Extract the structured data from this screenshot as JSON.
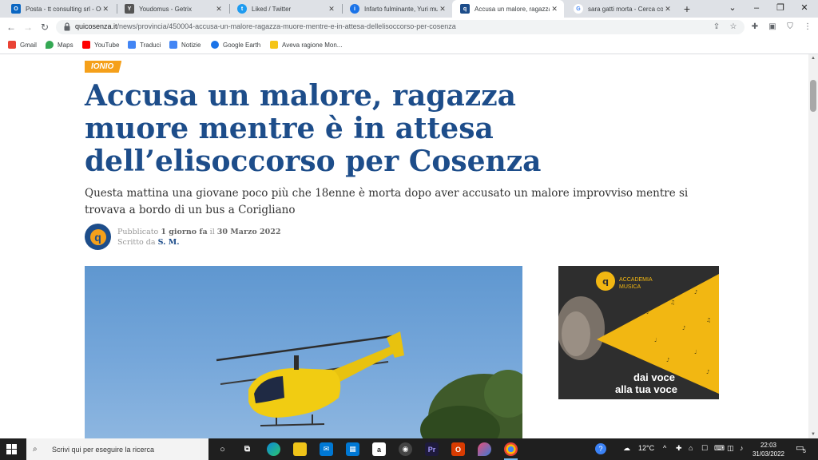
{
  "browser": {
    "tabs": [
      {
        "title": "Posta - tt consulting srl - Ou",
        "color": "#0a66c2",
        "glyph": "O"
      },
      {
        "title": "Youdomus - Getrix",
        "color": "#555555",
        "glyph": "Y"
      },
      {
        "title": "Liked / Twitter",
        "color": "#1d9bf0",
        "glyph": "t"
      },
      {
        "title": "Infarto fulminante, Yuri mu",
        "color": "#1a73e8",
        "glyph": "i"
      },
      {
        "title": "Accusa un malore, ragazza",
        "color": "#1d4d8a",
        "glyph": "q"
      },
      {
        "title": "sara gatti morta - Cerca co",
        "color": "#ffffff",
        "glyph": "G"
      }
    ],
    "new_tab": "+",
    "window_controls": [
      "⌄",
      "–",
      "❐",
      "✕"
    ],
    "url_domain": "quicosenza.it",
    "url_path": "/news/provincia/450004-accusa-un-malore-ragazza-muore-mentre-e-in-attesa-dellelisoccorso-per-cosenza",
    "bookmarks": [
      {
        "label": "Gmail",
        "color": "#ea4335"
      },
      {
        "label": "Maps",
        "color": "#34a853"
      },
      {
        "label": "YouTube",
        "color": "#ff0000"
      },
      {
        "label": "Traduci",
        "color": "#4285f4"
      },
      {
        "label": "Notizie",
        "color": "#4285f4"
      },
      {
        "label": "Google Earth",
        "color": "#1a73e8"
      },
      {
        "label": "Aveva ragione Mon...",
        "color": "#f5c518"
      }
    ]
  },
  "article": {
    "category": "IONIO",
    "headline": "Accusa un malore, ragazza muore mentre è in attesa dell’elisoccorso per Cosenza",
    "subhead": "Questa mattina una giovane poco più che 18enne è morta dopo aver accusato un malore improvviso mentre si trovava a bordo di un bus a Corigliano",
    "published_prefix": "Pubblicato",
    "published_relative": "1 giorno fa",
    "published_mid": "il",
    "published_date": "30 Marzo 2022",
    "written_prefix": "Scritto da",
    "author": "S. M."
  },
  "ad": {
    "brand_line1": "ACCADEMIA",
    "brand_line2": "MUSICA",
    "slogan_line1": "dai voce",
    "slogan_line2": "alla tua voce"
  },
  "taskbar": {
    "search_placeholder": "Scrivi qui per eseguire la ricerca",
    "weather": "12°C",
    "time": "22:03",
    "date": "31/03/2022",
    "notifications": "5"
  },
  "colors": {
    "brand_blue": "#1d4d8a",
    "brand_orange": "#f5a01a"
  }
}
